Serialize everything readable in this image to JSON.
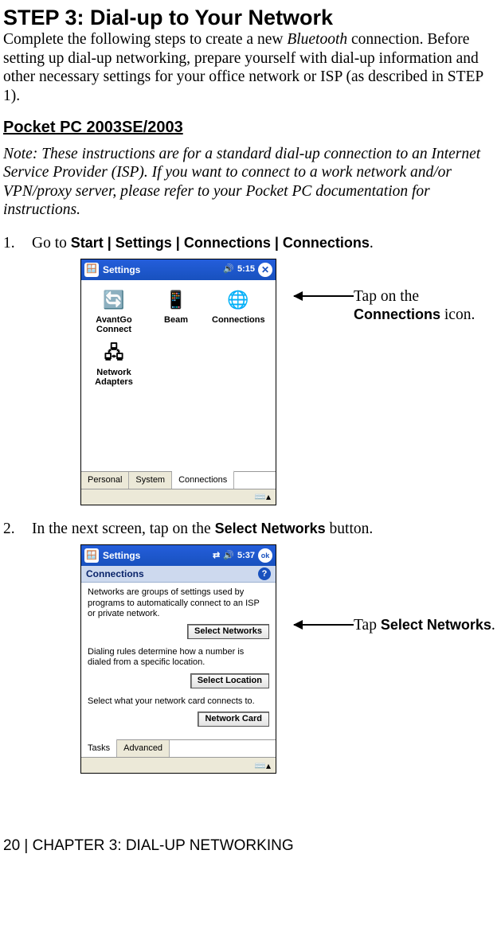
{
  "step": {
    "title": "STEP 3: Dial-up to Your Network",
    "intro_pre": "Complete the following steps to create a new ",
    "intro_em": "Bluetooth",
    "intro_post": " connection. Before setting up dial-up networking, prepare yourself with dial-up information and other necessary settings for your office network or ISP (as described in STEP 1)."
  },
  "section": {
    "heading": "Pocket PC 2003SE/2003",
    "note": "Note: These instructions are for a standard dial-up connection to an Internet Service Provider (ISP). If you want to connect to a work network and/or VPN/proxy server, please refer to your Pocket PC documentation for instructions."
  },
  "steps": {
    "s1": {
      "num": "1.",
      "pre": "Go to ",
      "bold": "Start | Settings | Connections | Connections",
      "post": "."
    },
    "s2": {
      "num": "2.",
      "pre": "In the next screen, tap on the ",
      "bold": "Select Networks",
      "post": " button."
    }
  },
  "callouts": {
    "c1_pre": "Tap on the ",
    "c1_bold": "Connections",
    "c1_post": " icon.",
    "c2_pre": "Tap ",
    "c2_bold": "Select Networks",
    "c2_post": "."
  },
  "ppc1": {
    "title": "Settings",
    "time": "5:15",
    "close": "✕",
    "icons": {
      "avantgo": "AvantGo Connect",
      "beam": "Beam",
      "connections": "Connections",
      "network_adapters": "Network Adapters"
    },
    "tabs": {
      "personal": "Personal",
      "system": "System",
      "connections": "Connections"
    }
  },
  "ppc2": {
    "title": "Settings",
    "time": "5:37",
    "ok": "ok",
    "subheader": "Connections",
    "body": {
      "p1": "Networks are groups of settings used by programs to automatically connect to an ISP or private network.",
      "btn1": "Select Networks",
      "p2": "Dialing rules determine how a number is dialed from a specific location.",
      "btn2": "Select Location",
      "p3": "Select what your network card connects to.",
      "btn3": "Network Card"
    },
    "tabs": {
      "tasks": "Tasks",
      "advanced": "Advanced"
    }
  },
  "footer": {
    "text": "20 | CHAPTER 3: DIAL-UP NETWORKING"
  }
}
